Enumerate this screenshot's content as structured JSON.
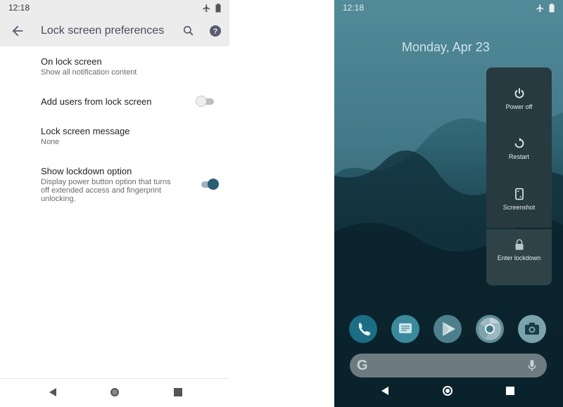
{
  "left_phone": {
    "status_time": "12:18",
    "app_title": "Lock screen preferences",
    "items": [
      {
        "title": "On lock screen",
        "subtitle": "Show all notification content"
      },
      {
        "title": "Add users from lock screen",
        "toggle": false
      },
      {
        "title": "Lock screen message",
        "subtitle": "None"
      },
      {
        "title": "Show lockdown option",
        "subtitle_lines": [
          "Display power button option that turns",
          "off extended access and fingerprint",
          "unlocking."
        ],
        "toggle": true
      }
    ]
  },
  "right_phone": {
    "status_time": "12:18",
    "date": "Monday, Apr 23",
    "power_menu": {
      "power_off": "Power off",
      "restart": "Restart",
      "screenshot": "Screenshot",
      "lockdown": "Enter lockdown"
    },
    "dock_apps": [
      "phone",
      "messages",
      "play-store",
      "chrome",
      "camera"
    ],
    "search_logo": "G"
  },
  "colors": {
    "accent": "#2a5e75",
    "wallpaper": "#0d2b36",
    "menu": "#273a40"
  }
}
